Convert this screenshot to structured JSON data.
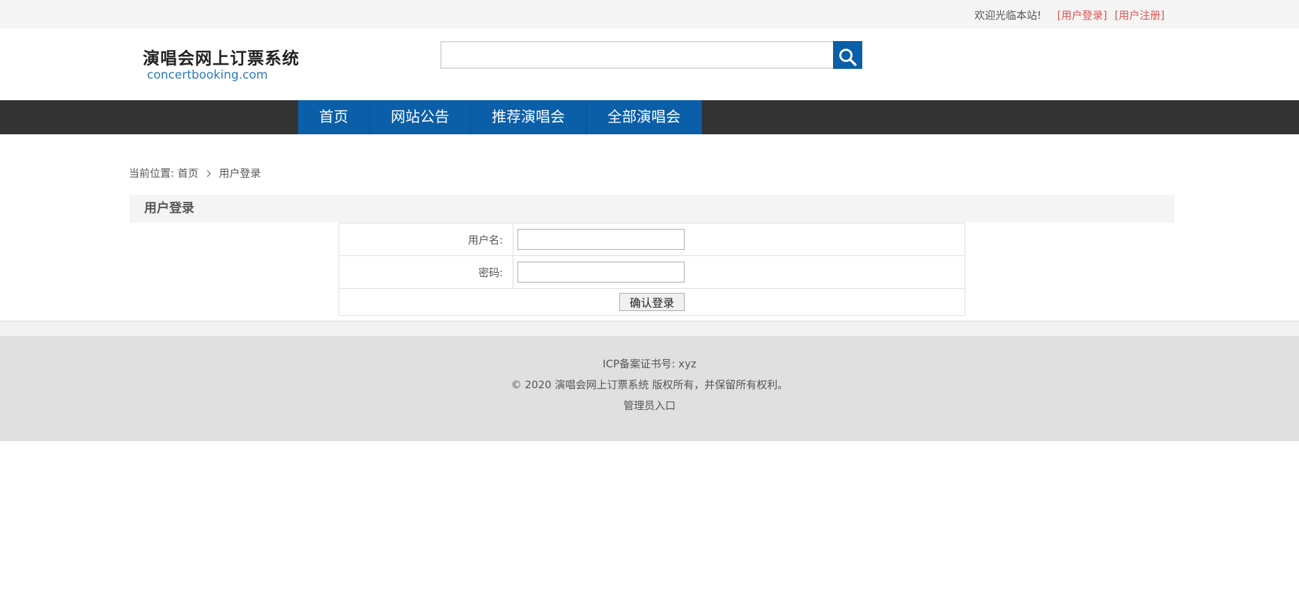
{
  "topbar": {
    "welcome": "欢迎光临本站!",
    "login_link": "[用户登录]",
    "register_link": "[用户注册]"
  },
  "header": {
    "logo_cn": "演唱会网上订票系统",
    "logo_en": "concertbooking.com",
    "search_value": "",
    "search_icon": "search-icon"
  },
  "nav": {
    "items": [
      {
        "label": "首页"
      },
      {
        "label": "网站公告"
      },
      {
        "label": "推荐演唱会"
      },
      {
        "label": "全部演唱会"
      }
    ]
  },
  "breadcrumb": {
    "prefix": "当前位置:",
    "home": "首页",
    "separator_icon": "chevron-right-icon",
    "current": "用户登录"
  },
  "login": {
    "title": "用户登录",
    "username_label": "用户名:",
    "username_value": "",
    "password_label": "密码:",
    "password_value": "",
    "submit_label": "确认登录"
  },
  "footer": {
    "icp": "ICP备案证书号: xyz",
    "copyright": "© 2020 演唱会网上订票系统 版权所有，并保留所有权利。",
    "admin_link": "管理员入口"
  },
  "colors": {
    "brand_blue": "#0b5ea8",
    "nav_bg": "#333333",
    "link_red": "#e05252",
    "footer_bg": "#e0e0e0"
  }
}
